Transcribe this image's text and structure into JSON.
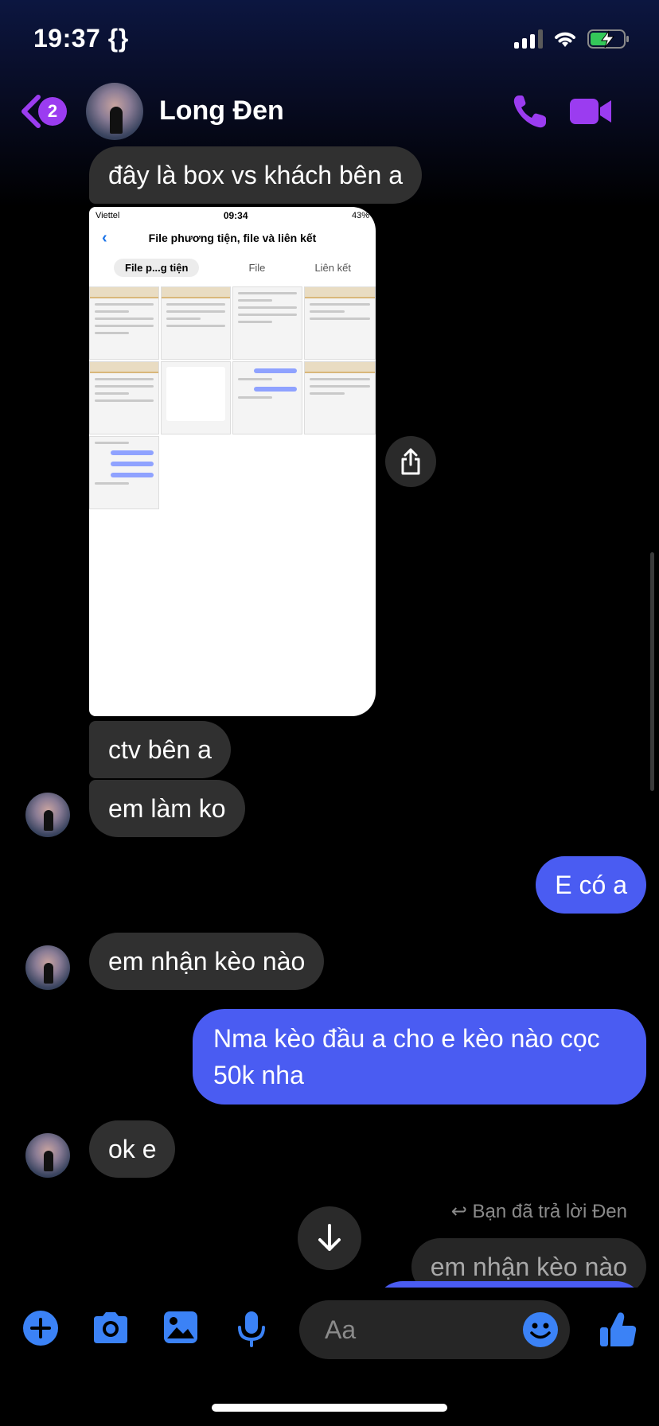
{
  "status_bar": {
    "time": "19:37 {}"
  },
  "header": {
    "back_badge": "2",
    "contact_name": "Long Đen"
  },
  "shared_image": {
    "status_carrier": "Viettel",
    "status_time": "09:34",
    "status_battery": "43%",
    "title": "File phương tiện, file và liên kết",
    "tabs": [
      "File p...g tiện",
      "File",
      "Liên kết"
    ]
  },
  "messages": [
    {
      "side": "in",
      "text": "đây là box vs khách bên a"
    },
    {
      "side": "in",
      "text": "ctv bên a"
    },
    {
      "side": "in",
      "text": "em làm ko"
    },
    {
      "side": "out",
      "text": "E có a"
    },
    {
      "side": "in",
      "text": "em nhận kèo nào"
    },
    {
      "side": "out",
      "text": "Nma kèo đầu a cho e kèo nào cọc 50k nha"
    },
    {
      "side": "in",
      "text": "ok e"
    }
  ],
  "reply": {
    "label": "Bạn đã trả lời Đen",
    "quoted": "em nhận kèo nào"
  },
  "composer": {
    "placeholder": "Aa"
  },
  "colors": {
    "accent": "#9b3cf0",
    "outgoing": "#4a5cf2",
    "composer_icons": "#3b82f6"
  }
}
